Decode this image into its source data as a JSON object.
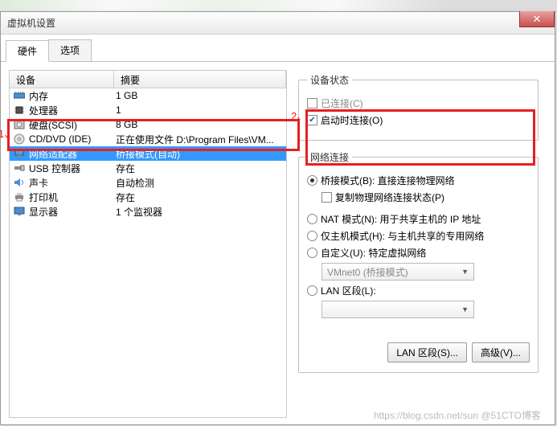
{
  "window": {
    "title": "虚拟机设置"
  },
  "tabs": {
    "hardware": "硬件",
    "options": "选项"
  },
  "list": {
    "header_device": "设备",
    "header_summary": "摘要",
    "rows": [
      {
        "name": "内存",
        "summary": "1 GB",
        "icon": "memory"
      },
      {
        "name": "处理器",
        "summary": "1",
        "icon": "cpu"
      },
      {
        "name": "硬盘(SCSI)",
        "summary": "8 GB",
        "icon": "hdd"
      },
      {
        "name": "CD/DVD (IDE)",
        "summary": "正在使用文件 D:\\Program Files\\VM...",
        "icon": "cd"
      },
      {
        "name": "网络适配器",
        "summary": "桥接模式(自动)",
        "icon": "net",
        "selected": true
      },
      {
        "name": "USB 控制器",
        "summary": "存在",
        "icon": "usb"
      },
      {
        "name": "声卡",
        "summary": "自动检测",
        "icon": "sound"
      },
      {
        "name": "打印机",
        "summary": "存在",
        "icon": "printer"
      },
      {
        "name": "显示器",
        "summary": "1 个监视器",
        "icon": "display"
      }
    ]
  },
  "status": {
    "legend": "设备状态",
    "connected": "已连接(C)",
    "connect_on_power": "启动时连接(O)"
  },
  "network": {
    "legend": "网络连接",
    "bridged": "桥接模式(B): 直接连接物理网络",
    "replicate": "复制物理网络连接状态(P)",
    "nat": "NAT 模式(N): 用于共享主机的 IP 地址",
    "hostonly": "仅主机模式(H): 与主机共享的专用网络",
    "custom": "自定义(U): 特定虚拟网络",
    "vmnet": "VMnet0 (桥接模式)",
    "lan": "LAN 区段(L):"
  },
  "buttons": {
    "lan_segments": "LAN 区段(S)...",
    "advanced": "高级(V)..."
  },
  "annotations": {
    "a1": "1、",
    "a2": "2、"
  },
  "watermark": "https://blog.csdn.net/sun @51CTO博客"
}
